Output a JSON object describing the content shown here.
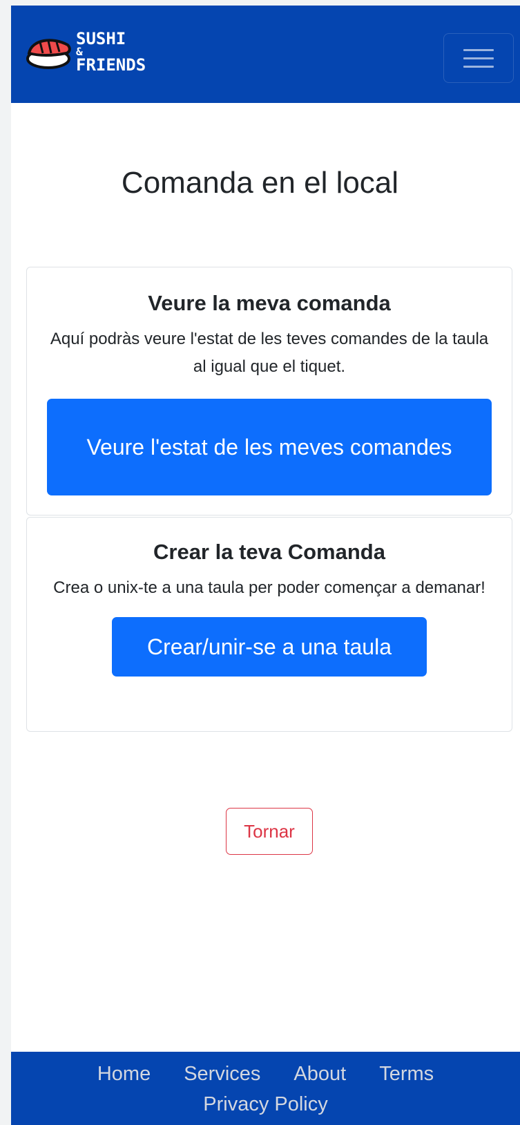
{
  "brand": {
    "line1": "SUSHI",
    "line2": "&",
    "line3": "FRIENDS",
    "logo_icon": "sushi-logo-icon"
  },
  "navbar": {
    "toggler_icon": "hamburger-menu-icon"
  },
  "page": {
    "title": "Comanda en el local"
  },
  "cards": [
    {
      "title": "Veure la meva comanda",
      "text": "Aquí podràs veure l'estat de les teves comandes de la taula al igual que el tiquet.",
      "button_label": "Veure l'estat de les meves comandes"
    },
    {
      "title": "Crear la teva Comanda",
      "text": "Crea o unix-te a una taula per poder començar a demanar!",
      "button_label": "Crear/unir-se a una taula"
    }
  ],
  "back_button_label": "Tornar",
  "footer": {
    "links": [
      "Home",
      "Services",
      "About",
      "Terms",
      "Privacy Policy"
    ]
  },
  "colors": {
    "navbar_bg": "#0545b0",
    "primary_button": "#0d6efd",
    "danger": "#dc3545"
  }
}
